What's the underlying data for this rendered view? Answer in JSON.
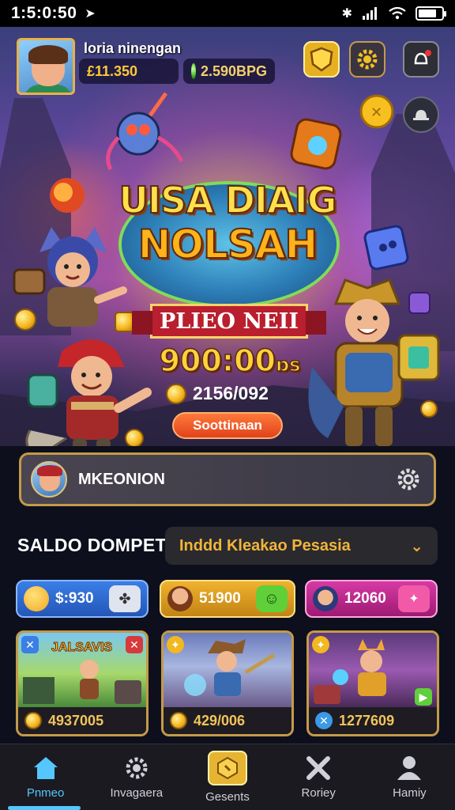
{
  "status_bar": {
    "time": "1:5:0:50",
    "battery_level": 0.8
  },
  "header": {
    "player_name": "loria ninengan",
    "gold_value": "£11.350",
    "gem_value": "2.590BPG"
  },
  "banner": {
    "title_line1": "UISA DIAIG",
    "title_line2": "NOLSAH",
    "ribbon_text": "PLIEO NEII",
    "prize_amount": "900:00",
    "prize_suffix": "ɒs",
    "coin_count": "2156/092",
    "cta_label": "Soottinaan"
  },
  "profile_card": {
    "name": "MKEONION"
  },
  "wallet": {
    "label": "SALDO DOMPET",
    "selected_option": "Inddd Kleakao Pesasia"
  },
  "currency_tiles": [
    {
      "value": "$:930",
      "color": "#2f6ed6"
    },
    {
      "value": "51900",
      "color": "#d49a1e"
    },
    {
      "value": "12060",
      "color": "#b32c84"
    }
  ],
  "game_cards": [
    {
      "title": "JALSAVIS",
      "value": "4937005"
    },
    {
      "title": "",
      "value": "429/006"
    },
    {
      "title": "",
      "value": "1277609"
    }
  ],
  "bottom_nav": [
    {
      "label": "Pnmeo",
      "icon": "home-icon"
    },
    {
      "label": "Invagaera",
      "icon": "gear-icon"
    },
    {
      "label": "Gesents",
      "icon": "hexagon-icon"
    },
    {
      "label": "Roriey",
      "icon": "cross-icon"
    },
    {
      "label": "Hamiy",
      "icon": "person-icon"
    }
  ]
}
